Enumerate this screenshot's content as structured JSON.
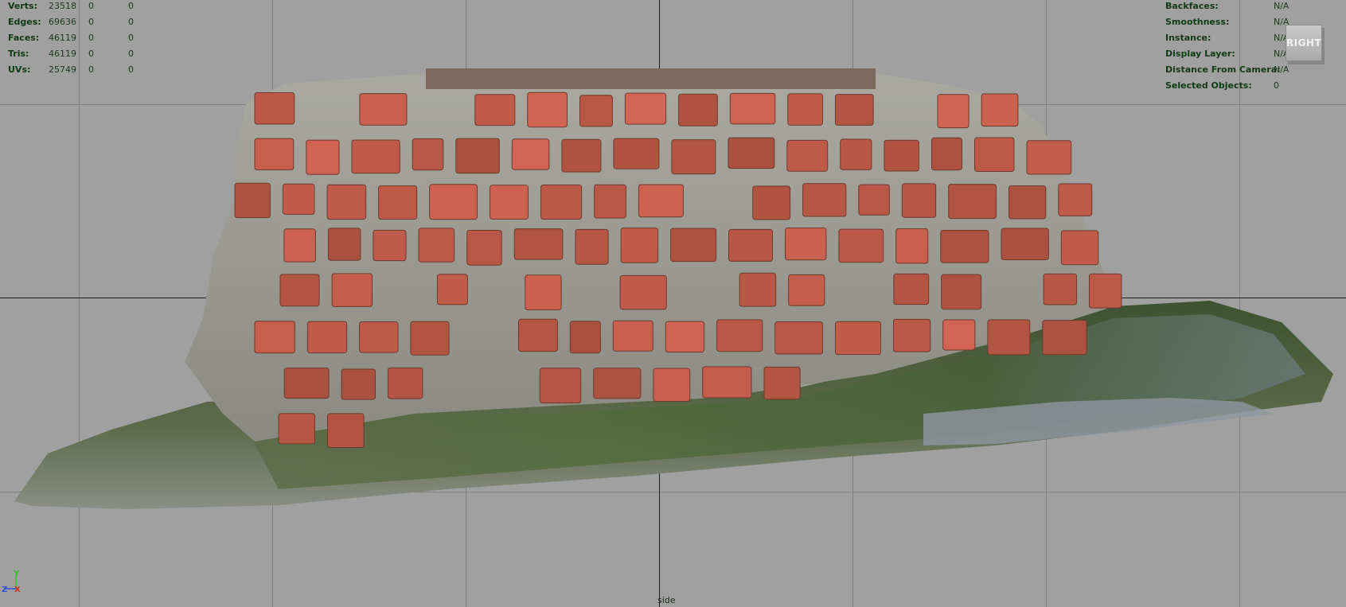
{
  "stats": [
    {
      "label": "Verts:",
      "values": [
        "23518",
        "0",
        "0"
      ]
    },
    {
      "label": "Edges:",
      "values": [
        "69636",
        "0",
        "0"
      ]
    },
    {
      "label": "Faces:",
      "values": [
        "46119",
        "0",
        "0"
      ]
    },
    {
      "label": "Tris:",
      "values": [
        "46119",
        "0",
        "0"
      ]
    },
    {
      "label": "UVs:",
      "values": [
        "25749",
        "0",
        "0"
      ]
    }
  ],
  "info": [
    {
      "label": "Backfaces:",
      "value": "N/A"
    },
    {
      "label": "Smoothness:",
      "value": "N/A"
    },
    {
      "label": "Instance:",
      "value": "N/A"
    },
    {
      "label": "Display Layer:",
      "value": "N/A"
    },
    {
      "label": "Distance From Camera:",
      "value": "N/A"
    },
    {
      "label": "Selected Objects:",
      "value": "0"
    }
  ],
  "view_cube": {
    "label": "RIGHT"
  },
  "camera": {
    "name": "side"
  },
  "axes": {
    "up": "Y",
    "left": "Z",
    "center": "X"
  },
  "colors": {
    "background": "#a0a0a0",
    "hud_text": "#0f3a12",
    "brick": "#b85a44",
    "mortar": "#9a9a92",
    "grass": "#4e6a36"
  }
}
